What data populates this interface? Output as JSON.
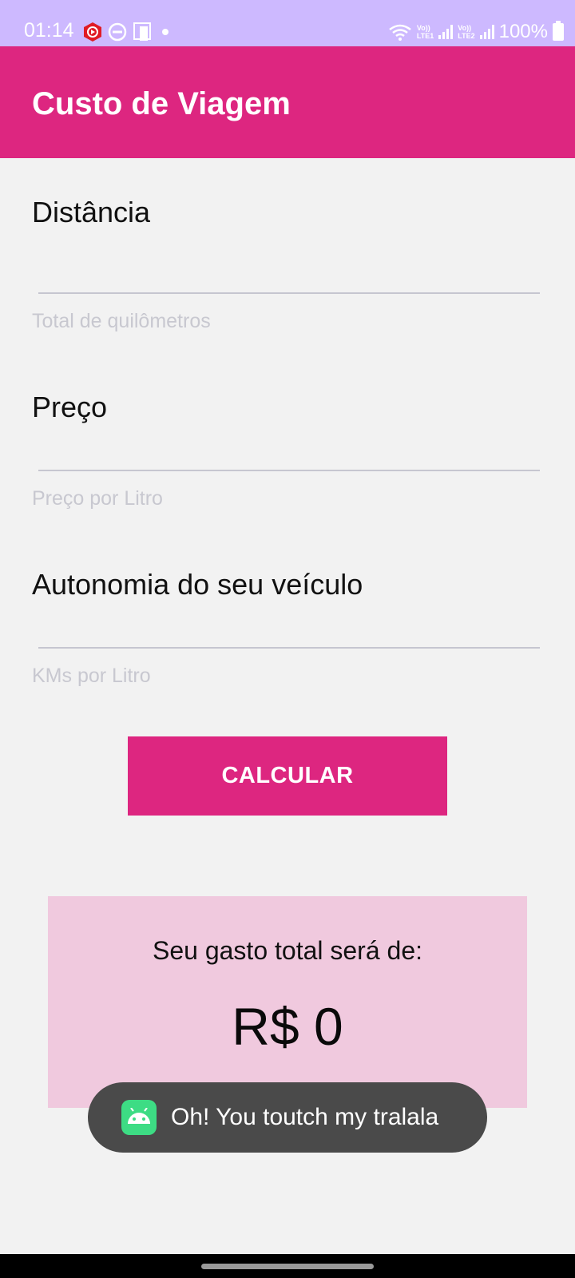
{
  "status_bar": {
    "time": "01:14",
    "battery": "100%",
    "sim1": "LTE1",
    "sim2": "LTE2",
    "volte": "Vo))",
    "icons": [
      "youtube-music-icon",
      "do-not-disturb-icon",
      "screen-mirror-icon",
      "dot-icon",
      "wifi-icon",
      "signal-icon",
      "battery-icon"
    ]
  },
  "app_bar": {
    "title": "Custo de Viagem",
    "color": "#dd2680"
  },
  "form": {
    "distance": {
      "label": "Distância",
      "value": "",
      "hint": "Total de quilômetros"
    },
    "price": {
      "label": "Preço",
      "value": "",
      "hint": "Preço por Litro"
    },
    "autonomy": {
      "label": "Autonomia do seu veículo",
      "value": "",
      "hint": "KMs por Litro"
    }
  },
  "calculate_button": {
    "label": "CALCULAR"
  },
  "result": {
    "label": "Seu gasto total será de:",
    "value": "R$ 0",
    "background": "#f0c9de"
  },
  "toast": {
    "icon": "android-icon",
    "message": "Oh! You toutch my tralala"
  }
}
